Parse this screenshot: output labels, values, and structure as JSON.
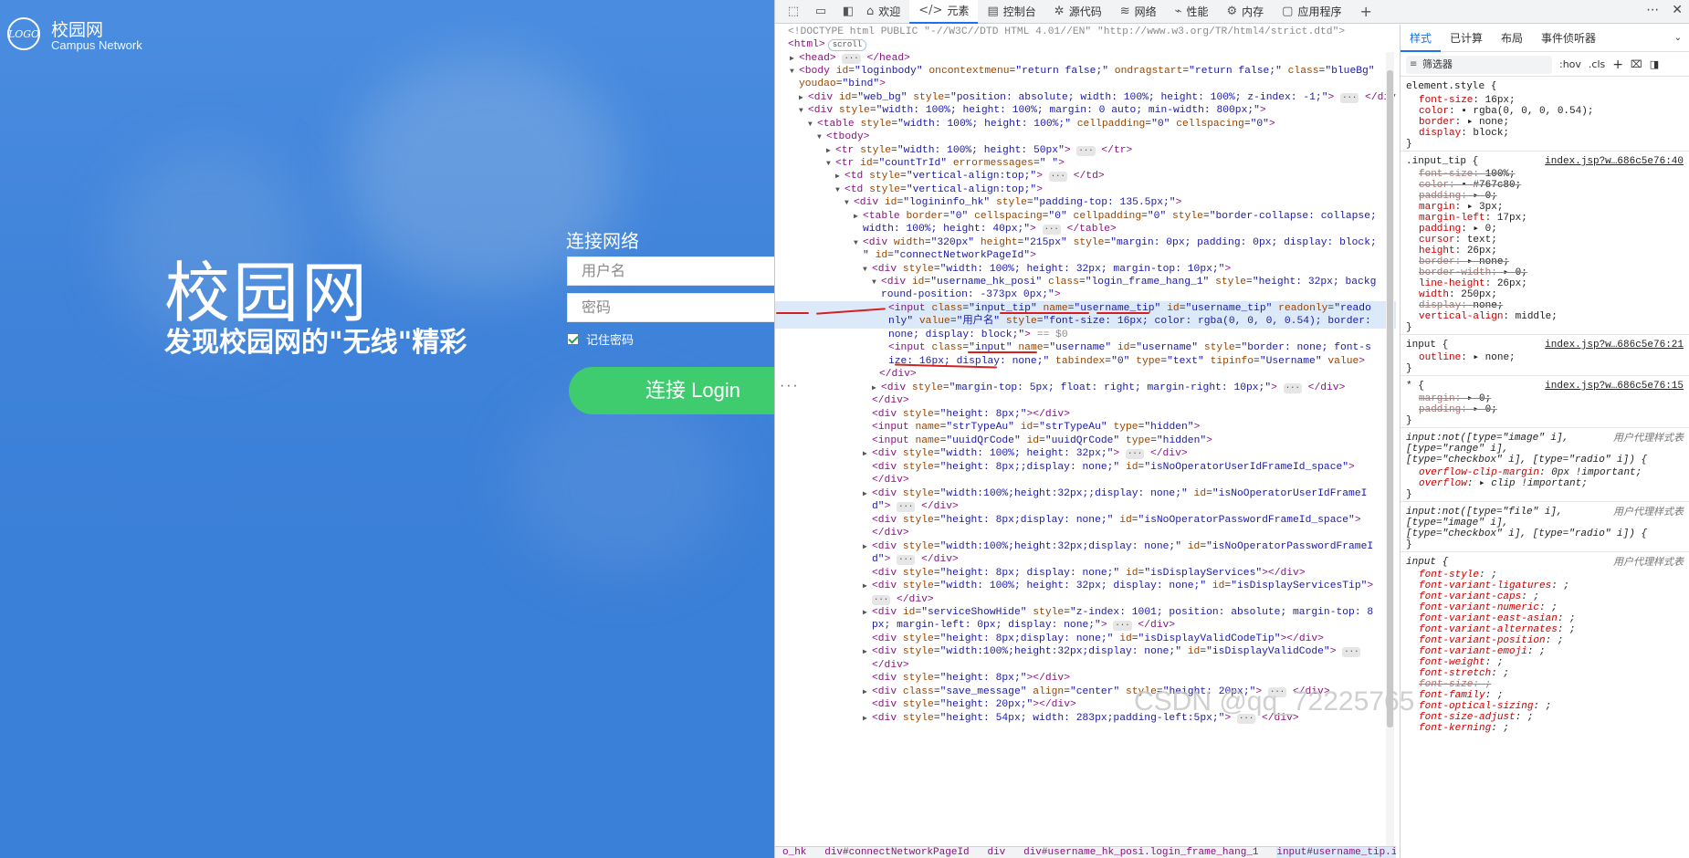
{
  "login": {
    "brand_cn": "校园网",
    "brand_en": "Campus Network",
    "logo_text": "LOGO",
    "hero_title": "校园网",
    "hero_subtitle": "发现校园网的\"无线\"精彩",
    "connect_title": "连接网络",
    "username_placeholder": "用户名",
    "password_placeholder": "密码",
    "remember_label": "记住密码",
    "remember_checked": true,
    "login_button": "连接 Login",
    "colors": {
      "background": "#3f83da",
      "button": "#3ecc6f"
    }
  },
  "devtools": {
    "tabs": [
      {
        "label": "欢迎",
        "icon": "home-icon"
      },
      {
        "label": "元素",
        "icon": "code-icon",
        "active": true
      },
      {
        "label": "控制台",
        "icon": "console-icon"
      },
      {
        "label": "源代码",
        "icon": "bug-icon"
      },
      {
        "label": "网络",
        "icon": "wifi-icon"
      },
      {
        "label": "性能",
        "icon": "performance-icon"
      },
      {
        "label": "内存",
        "icon": "memory-icon"
      },
      {
        "label": "应用程序",
        "icon": "application-icon"
      }
    ],
    "styles_tabs": [
      "样式",
      "已计算",
      "布局",
      "事件侦听器"
    ],
    "filter_placeholder": "筛选器",
    "filter_buttons": [
      ":hov",
      ".cls"
    ],
    "breadcrumb": [
      "o_hk",
      "div#connectNetworkPageId",
      "div",
      "div#username_hk_posi.login_frame_hang_1",
      "input#username_tip.input_tip"
    ],
    "watermark": "CSDN @qq_72225765"
  }
}
